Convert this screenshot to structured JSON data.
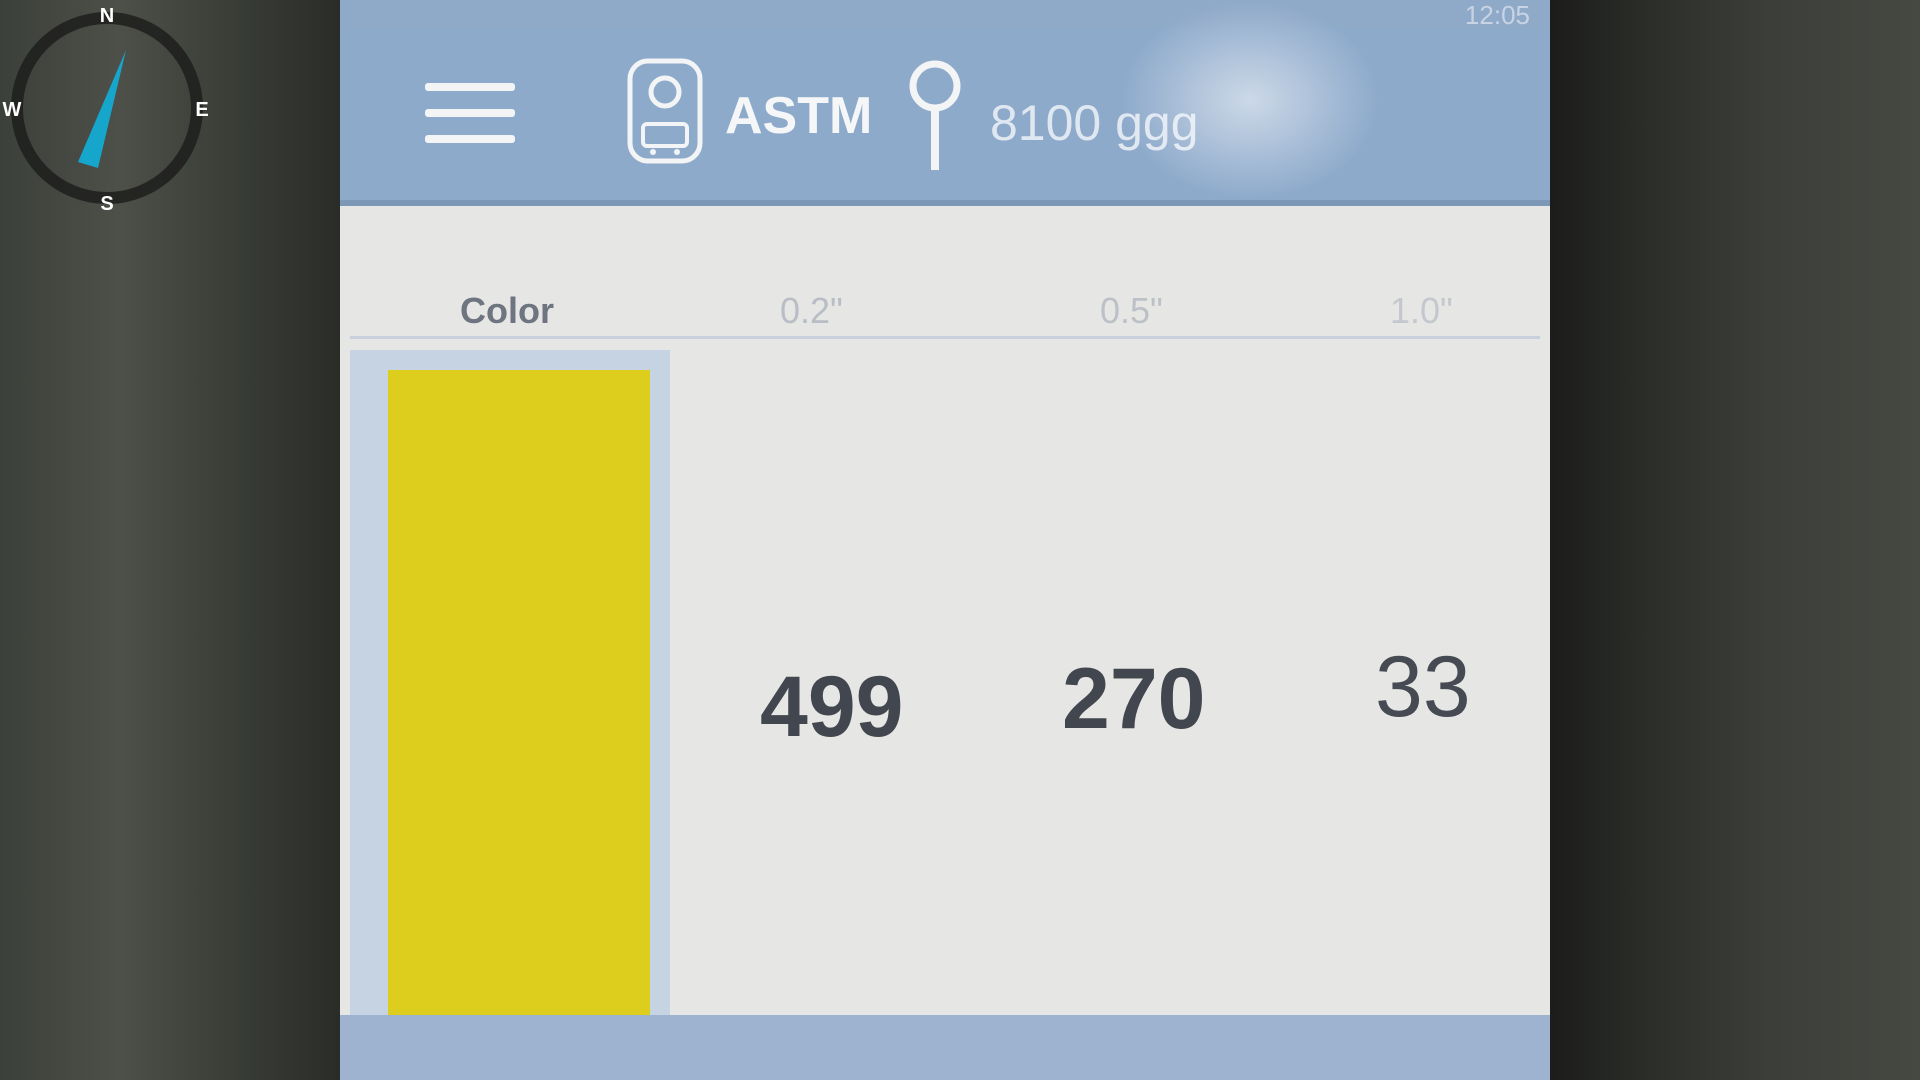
{
  "status_bar": {
    "time": "12:05"
  },
  "app_bar": {
    "menu_icon": "hamburger-menu-icon",
    "device_icon": "device-icon",
    "device_label": "ASTM",
    "location_icon": "map-pin-icon",
    "location_label": "8100 ggg"
  },
  "table": {
    "headers": [
      "Color",
      "0.2\"",
      "0.5\"",
      "1.0\""
    ],
    "row": {
      "swatch_color": "#ddcd1d",
      "values": [
        "499",
        "270",
        "33"
      ]
    }
  },
  "compass": {
    "north": "N",
    "south": "S",
    "east": "E",
    "west": "W",
    "needle_color": "#16a6cc"
  }
}
